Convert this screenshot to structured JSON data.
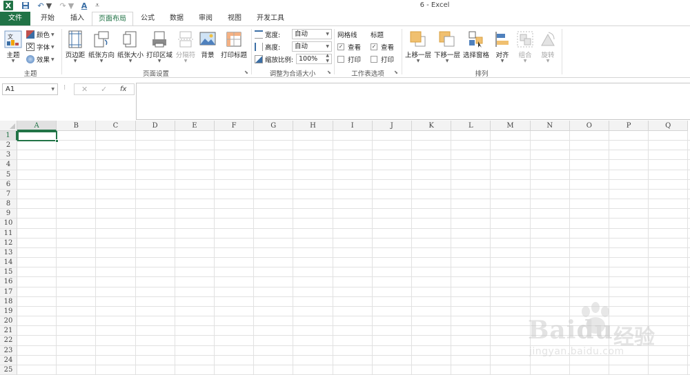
{
  "app": {
    "window_title": "6 - Excel"
  },
  "quick_access": {
    "logo": "X",
    "save_icon": "save-icon",
    "undo_icon": "undo-icon",
    "redo_icon": "redo-icon",
    "font_color_label": "A"
  },
  "tabs": [
    {
      "label": "文件"
    },
    {
      "label": "开始"
    },
    {
      "label": "插入"
    },
    {
      "label": "页面布局"
    },
    {
      "label": "公式"
    },
    {
      "label": "数据"
    },
    {
      "label": "审阅"
    },
    {
      "label": "视图"
    },
    {
      "label": "开发工具"
    }
  ],
  "ribbon": {
    "themes": {
      "group_label": "主题",
      "theme_label": "主题",
      "colors_label": "颜色",
      "fonts_label": "字体",
      "effects_label": "效果"
    },
    "page_setup": {
      "group_label": "页面设置",
      "margins": "页边距",
      "orientation": "纸张方向",
      "size": "纸张大小",
      "print_area": "打印区域",
      "breaks": "分隔符",
      "background": "背景",
      "print_titles": "打印标题"
    },
    "scale_to_fit": {
      "group_label": "调整为合适大小",
      "width_label": "宽度:",
      "width_value": "自动",
      "height_label": "高度:",
      "height_value": "自动",
      "scale_label": "缩放比例:",
      "scale_value": "100%"
    },
    "sheet_options": {
      "group_label": "工作表选项",
      "gridlines_title": "网格线",
      "headings_title": "标题",
      "view_label": "查看",
      "print_label": "打印",
      "view_check": "✓"
    },
    "arrange": {
      "group_label": "排列",
      "bring_forward": "上移一层",
      "send_backward": "下移一层",
      "selection_pane": "选择窗格",
      "align": "对齐",
      "group": "组合",
      "rotate": "旋转"
    }
  },
  "formula_bar": {
    "name_box": "A1",
    "dots": "⁝",
    "cancel": "✕",
    "enter": "✓",
    "fx": "fx",
    "content": ""
  },
  "sheet": {
    "columns": [
      "A",
      "B",
      "C",
      "D",
      "E",
      "F",
      "G",
      "H",
      "I",
      "J",
      "K",
      "L",
      "M",
      "N",
      "O",
      "P",
      "Q"
    ],
    "rows": [
      "1",
      "2",
      "3",
      "4",
      "5",
      "6",
      "7",
      "8",
      "9",
      "10",
      "11",
      "12",
      "13",
      "14",
      "15",
      "16",
      "17",
      "18",
      "19",
      "20",
      "21",
      "22",
      "23",
      "24",
      "25"
    ],
    "active_cell": "A1"
  },
  "watermark": {
    "brand": "Bai",
    "brand2": "du",
    "cn": "经验",
    "url": "jingyan.baidu.com"
  }
}
